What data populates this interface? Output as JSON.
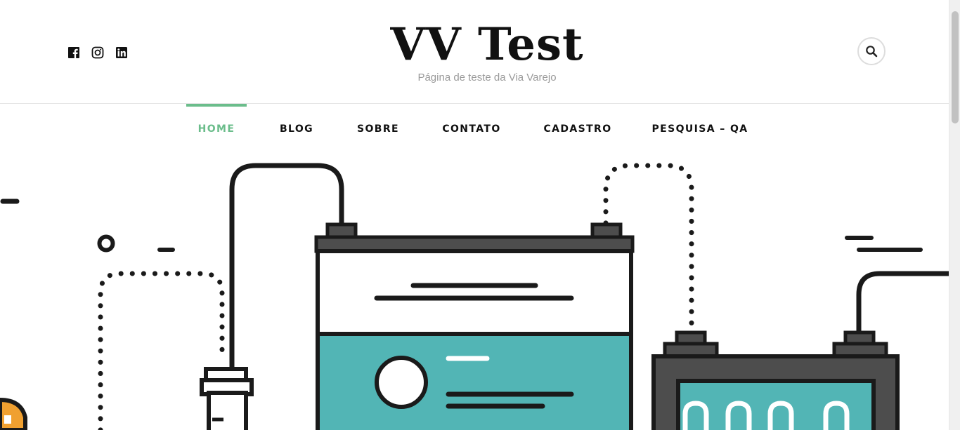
{
  "header": {
    "site_title": "VV Test",
    "tagline": "Página de teste da Via Varejo",
    "social": [
      {
        "name": "facebook-icon"
      },
      {
        "name": "instagram-icon"
      },
      {
        "name": "linkedin-icon"
      }
    ],
    "search_icon": "search-icon"
  },
  "nav": {
    "items": [
      {
        "label": "HOME",
        "active": true
      },
      {
        "label": "BLOG",
        "active": false
      },
      {
        "label": "SOBRE",
        "active": false
      },
      {
        "label": "CONTATO",
        "active": false
      },
      {
        "label": "CADASTRO",
        "active": false
      },
      {
        "label": "PESQUISA – QA",
        "active": false
      }
    ],
    "active_color": "#6bbd8b"
  },
  "hero": {
    "illustration": "batteries-illustration",
    "colors": {
      "teal": "#52b5b5",
      "dark": "#1a1a1a",
      "grey": "#4d4d4d",
      "orange": "#f0a030"
    }
  }
}
